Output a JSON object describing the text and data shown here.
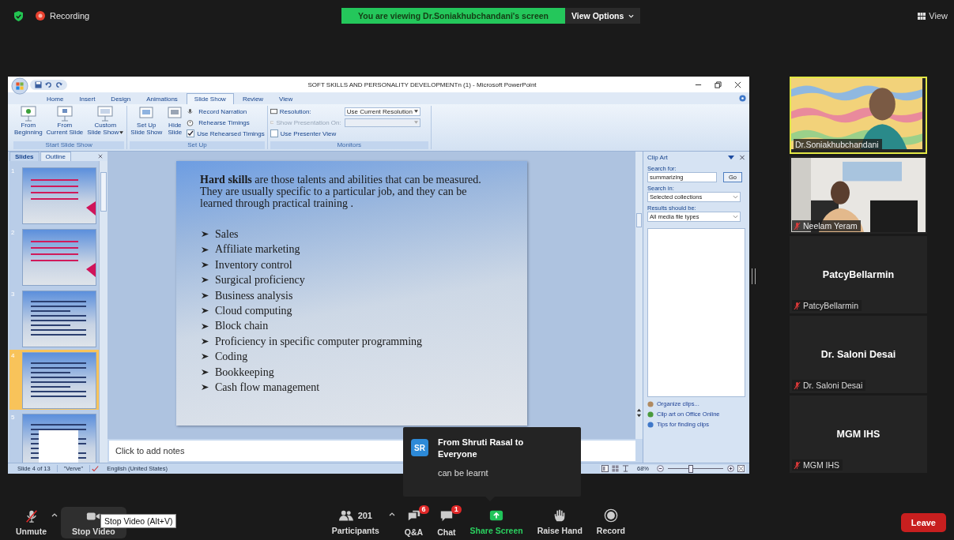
{
  "top_bar": {
    "recording": "Recording",
    "banner": "You are viewing Dr.Soniakhubchandani's screen",
    "view_options": "View Options",
    "view": "View"
  },
  "powerpoint": {
    "title": "SOFT SKILLS AND PERSONALITY DEVELOPMENTn (1) - Microsoft PowerPoint",
    "tabs": [
      {
        "label": "Home",
        "selected": false
      },
      {
        "label": "Insert",
        "selected": false
      },
      {
        "label": "Design",
        "selected": false
      },
      {
        "label": "Animations",
        "selected": false
      },
      {
        "label": "Slide Show",
        "selected": true
      },
      {
        "label": "Review",
        "selected": false
      },
      {
        "label": "View",
        "selected": false
      }
    ],
    "ribbon": {
      "start_group": {
        "label": "Start Slide Show",
        "buttons": [
          {
            "label": "From\nBeginning",
            "dropdown": false
          },
          {
            "label": "From\nCurrent Slide",
            "dropdown": false
          },
          {
            "label": "Custom\nSlide Show",
            "dropdown": true
          }
        ]
      },
      "setup_group": {
        "label": "Set Up",
        "buttons": [
          {
            "label": "Set Up\nSlide Show"
          },
          {
            "label": "Hide\nSlide"
          }
        ],
        "record_narration": "Record Narration",
        "rehearse_timings": "Rehearse Timings",
        "use_rehearsed": {
          "label": "Use Rehearsed Timings",
          "checked": true
        }
      },
      "monitors_group": {
        "label": "Monitors",
        "resolution_label": "Resolution:",
        "resolution_value": "Use Current Resolution",
        "show_on_label": "Show Presentation On:",
        "show_on_disabled": true,
        "presenter_view": {
          "label": "Use Presenter View",
          "checked": false
        }
      }
    },
    "panel_tabs": [
      {
        "label": "Slides",
        "selected": true
      },
      {
        "label": "Outline",
        "selected": false
      }
    ],
    "slides": [
      {
        "number": "1",
        "selected": false
      },
      {
        "number": "2",
        "selected": false
      },
      {
        "number": "3",
        "selected": false
      },
      {
        "number": "4",
        "selected": true
      },
      {
        "number": "5",
        "selected": false
      }
    ],
    "slide": {
      "intro": "**Hard skills** are those talents and abilities that can be measured. They are usually specific to a particular job, and they can be learned through practical training .",
      "bullets": [
        "Sales",
        "Affiliate marketing",
        "Inventory control",
        "Surgical proficiency",
        "Business analysis",
        "Cloud computing",
        "Block chain",
        "Proficiency in specific computer programming",
        "Coding",
        "Bookkeeping",
        "Cash flow management"
      ]
    },
    "notes_placeholder": "Click to add notes",
    "clip_art": {
      "title": "Clip Art",
      "search_label": "Search for:",
      "search_value": "summarizing",
      "go": "Go",
      "search_in_label": "Search in:",
      "search_in_value": "Selected collections",
      "results_label": "Results should be:",
      "results_value": "All media file types",
      "links": [
        "Organize clips...",
        "Clip art on Office Online",
        "Tips for finding clips"
      ]
    },
    "status_bar": {
      "slide": "Slide 4 of 13",
      "theme": "\"Verve\"",
      "language": "English (United States)",
      "zoom": "68%",
      "zoom_level": {
        "level": 0.42
      }
    }
  },
  "participants": [
    {
      "kind": "video",
      "name": "Dr.Soniakhubchandani",
      "active": true,
      "muted": false
    },
    {
      "kind": "video",
      "name": "Neelam Yeram",
      "active": false,
      "muted": true
    },
    {
      "kind": "name",
      "heading": "PatcyBellarmin",
      "name": "PatcyBellarmin",
      "active": false,
      "muted": true
    },
    {
      "kind": "name",
      "heading": "Dr. Saloni Desai",
      "name": "Dr. Saloni Desai",
      "active": false,
      "muted": true
    },
    {
      "kind": "name",
      "heading": "MGM IHS",
      "name": "MGM IHS",
      "active": false,
      "muted": true
    }
  ],
  "chat_popup": {
    "avatar": "SR",
    "sender": "From Shruti Rasal to Everyone",
    "message": "can be learnt"
  },
  "tooltip": "Stop Video (Alt+V)",
  "toolbar": {
    "audio": {
      "label": "Unmute",
      "muted": true
    },
    "video": {
      "label": "Stop Video"
    },
    "participants": {
      "label": "Participants",
      "count": "201"
    },
    "qa": {
      "label": "Q&A",
      "badge": "6"
    },
    "chat": {
      "label": "Chat",
      "badge": "1"
    },
    "share": {
      "label": "Share Screen"
    },
    "raise_hand": {
      "label": "Raise Hand"
    },
    "record": {
      "label": "Record"
    },
    "leave": "Leave"
  }
}
